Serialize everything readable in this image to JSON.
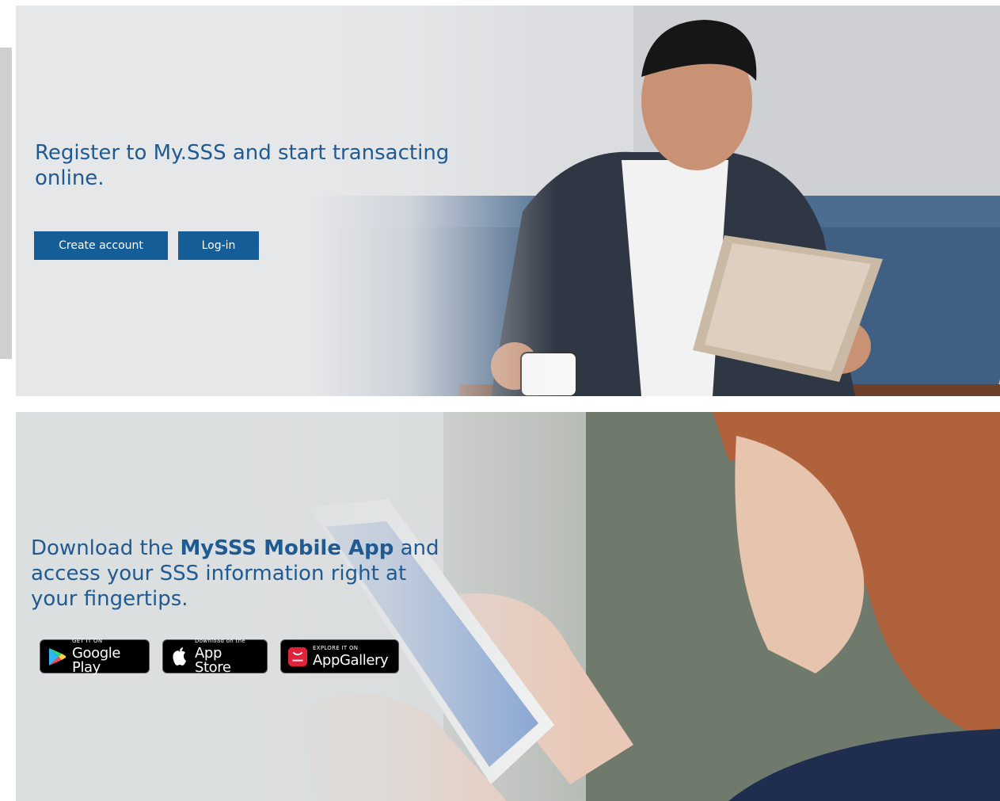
{
  "register_banner": {
    "headline": "Register to My.SSS and start transacting online.",
    "create_account_label": "Create account",
    "login_label": "Log-in",
    "accent_color": "#155d96"
  },
  "mobile_banner": {
    "headline_prefix": "Download the ",
    "headline_bold": "MySSS Mobile App",
    "headline_suffix": " and access your SSS information right at your fingertips.",
    "badges": [
      {
        "icon": "google-play-icon",
        "small": "GET IT ON",
        "big": "Google Play"
      },
      {
        "icon": "apple-icon",
        "small": "Download on the",
        "big": "App Store"
      },
      {
        "icon": "huawei-icon",
        "small": "EXPLORE IT ON",
        "big": "AppGallery"
      }
    ]
  }
}
